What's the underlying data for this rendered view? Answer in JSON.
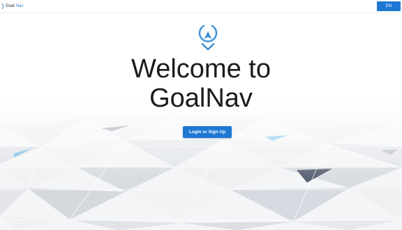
{
  "header": {
    "brand_prefix": "Goal",
    "brand_suffix": "Nav",
    "language_button": "EN"
  },
  "hero": {
    "title_line1": "Welcome to",
    "title_line2": "GoalNav",
    "cta_label": "Login or Sign Up",
    "logo_icon": "location-compass-icon"
  },
  "colors": {
    "accent": "#1e77d3",
    "title": "#1b1b1b"
  }
}
